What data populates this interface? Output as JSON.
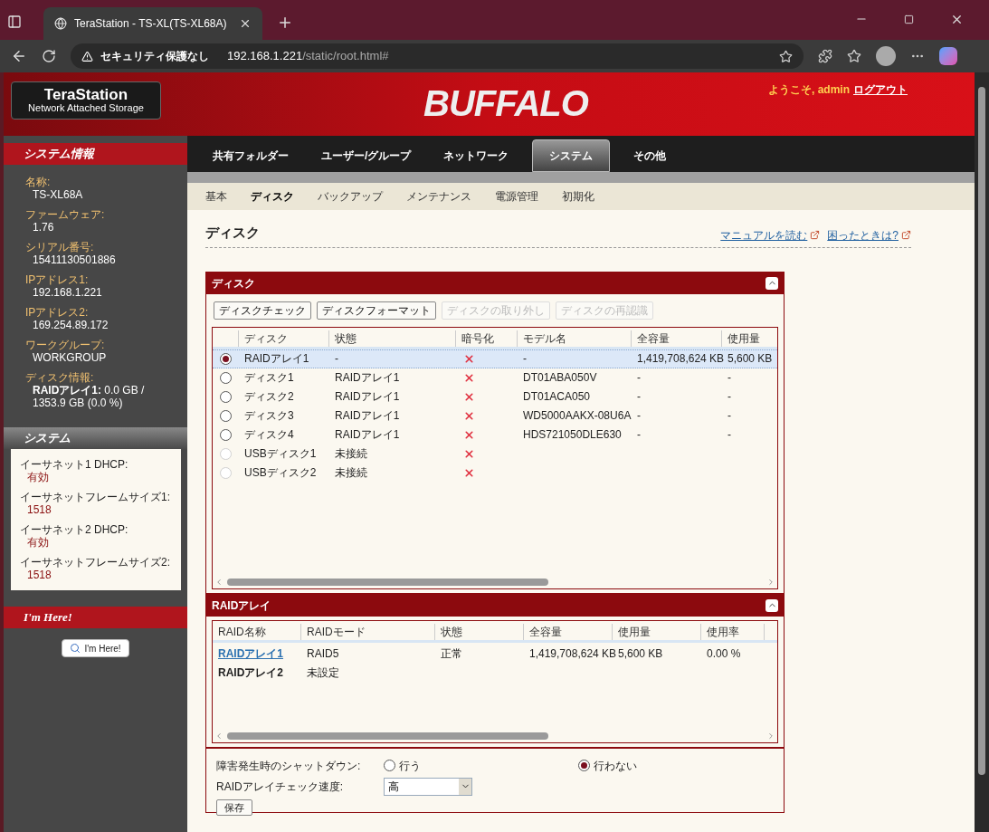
{
  "browser": {
    "tab_title": "TeraStation - TS-XL(TS-XL68A)",
    "security_label": "セキュリティ保護なし",
    "url_host": "192.168.1.221",
    "url_path": "/static/root.html#"
  },
  "header": {
    "logo_title": "TeraStation",
    "logo_subtitle": "Network Attached Storage",
    "brand": "BUFFALO",
    "welcome": "ようこそ, admin",
    "logout": "ログアウト"
  },
  "sidebar": {
    "system_info": {
      "title": "システム情報",
      "items": [
        {
          "label": "名称:",
          "value": "TS-XL68A"
        },
        {
          "label": "ファームウェア:",
          "value": "1.76"
        },
        {
          "label": "シリアル番号:",
          "value": "15411130501886"
        },
        {
          "label": "IPアドレス1:",
          "value": "192.168.1.221"
        },
        {
          "label": "IPアドレス2:",
          "value": "169.254.89.172"
        },
        {
          "label": "ワークグループ:",
          "value": "WORKGROUP"
        },
        {
          "label": "ディスク情報:",
          "value": "**RAIDアレイ1:** 0.0 GB / 1353.9 GB (0.0 %)"
        }
      ]
    },
    "system": {
      "title": "システム",
      "items": [
        {
          "label": "イーサネット1 DHCP:",
          "value": "有効"
        },
        {
          "label": "イーサネットフレームサイズ1:",
          "value": "1518"
        },
        {
          "label": "イーサネット2 DHCP:",
          "value": "有効"
        },
        {
          "label": "イーサネットフレームサイズ2:",
          "value": "1518"
        }
      ]
    },
    "im_here": {
      "title": "I'm Here!",
      "button": "I'm Here!"
    }
  },
  "nav": {
    "tabs": [
      {
        "label": "共有フォルダー",
        "selected": false
      },
      {
        "label": "ユーザー/グループ",
        "selected": false
      },
      {
        "label": "ネットワーク",
        "selected": false
      },
      {
        "label": "システム",
        "selected": true
      },
      {
        "label": "その他",
        "selected": false
      }
    ],
    "subtabs": [
      {
        "label": "基本",
        "selected": false
      },
      {
        "label": "ディスク",
        "selected": true
      },
      {
        "label": "バックアップ",
        "selected": false
      },
      {
        "label": "メンテナンス",
        "selected": false
      },
      {
        "label": "電源管理",
        "selected": false
      },
      {
        "label": "初期化",
        "selected": false
      }
    ]
  },
  "page": {
    "title": "ディスク",
    "links": [
      "マニュアルを読む",
      "困ったときは?"
    ]
  },
  "disk_panel": {
    "title": "ディスク",
    "buttons": [
      {
        "label": "ディスクチェック",
        "disabled": false
      },
      {
        "label": "ディスクフォーマット",
        "disabled": false
      },
      {
        "label": "ディスクの取り外し",
        "disabled": true
      },
      {
        "label": "ディスクの再認識",
        "disabled": true
      }
    ],
    "columns": [
      "ディスク",
      "状態",
      "暗号化",
      "モデル名",
      "全容量",
      "使用量"
    ],
    "rows": [
      {
        "selected": true,
        "disabled": false,
        "encrypted": false,
        "cells": [
          "RAIDアレイ1",
          "-",
          "",
          "-",
          "1,419,708,624 KB",
          "5,600 KB"
        ]
      },
      {
        "selected": false,
        "disabled": false,
        "encrypted": false,
        "cells": [
          "ディスク1",
          "RAIDアレイ1",
          "",
          "DT01ABA050V",
          "-",
          "-"
        ]
      },
      {
        "selected": false,
        "disabled": false,
        "encrypted": false,
        "cells": [
          "ディスク2",
          "RAIDアレイ1",
          "",
          "DT01ACA050",
          "-",
          "-"
        ]
      },
      {
        "selected": false,
        "disabled": false,
        "encrypted": false,
        "cells": [
          "ディスク3",
          "RAIDアレイ1",
          "",
          "WD5000AAKX-08U6A",
          "-",
          "-"
        ]
      },
      {
        "selected": false,
        "disabled": false,
        "encrypted": false,
        "cells": [
          "ディスク4",
          "RAIDアレイ1",
          "",
          "HDS721050DLE630",
          "-",
          "-"
        ]
      },
      {
        "selected": false,
        "disabled": true,
        "encrypted": false,
        "cells": [
          "USBディスク1",
          "未接続",
          "",
          "",
          "",
          ""
        ]
      },
      {
        "selected": false,
        "disabled": true,
        "encrypted": false,
        "cells": [
          "USBディスク2",
          "未接続",
          "",
          "",
          "",
          ""
        ]
      }
    ]
  },
  "raid_panel": {
    "title": "RAIDアレイ",
    "columns": [
      "RAID名称",
      "RAIDモード",
      "状態",
      "全容量",
      "使用量",
      "使用率"
    ],
    "rows": [
      {
        "kind": "link",
        "cells": [
          "RAIDアレイ1",
          "RAID5",
          "正常",
          "1,419,708,624 KB",
          "5,600 KB",
          "0.00 %"
        ]
      },
      {
        "kind": "bold",
        "cells": [
          "RAIDアレイ2",
          "未設定",
          "",
          "",
          "",
          ""
        ]
      }
    ]
  },
  "settings": {
    "shutdown_label": "障害発生時のシャットダウン:",
    "shutdown_options": [
      {
        "label": "行う",
        "selected": false
      },
      {
        "label": "行わない",
        "selected": true
      }
    ],
    "speed_label": "RAIDアレイチェック速度:",
    "speed_value": "高",
    "save": "保存"
  }
}
